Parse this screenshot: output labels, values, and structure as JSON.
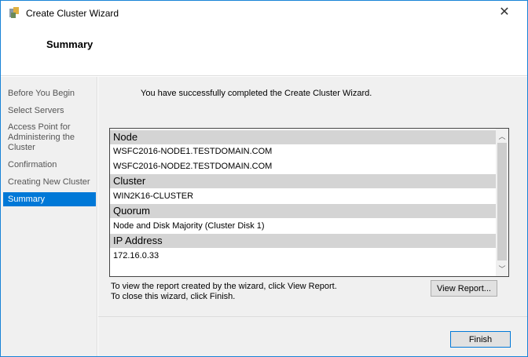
{
  "window": {
    "title": "Create Cluster Wizard",
    "close": "✕"
  },
  "header": {
    "title": "Summary"
  },
  "nav": {
    "items": [
      {
        "label": "Before You Begin"
      },
      {
        "label": "Select Servers"
      },
      {
        "label": "Access Point for Administering the Cluster"
      },
      {
        "label": "Confirmation"
      },
      {
        "label": "Creating New Cluster"
      },
      {
        "label": "Summary",
        "selected": true
      }
    ]
  },
  "main": {
    "message": "You have successfully completed the Create Cluster Wizard.",
    "sections": [
      {
        "header": "Node",
        "values": [
          "WSFC2016-NODE1.TESTDOMAIN.COM",
          "WSFC2016-NODE2.TESTDOMAIN.COM"
        ]
      },
      {
        "header": "Cluster",
        "values": [
          "WIN2K16-CLUSTER"
        ]
      },
      {
        "header": "Quorum",
        "values": [
          "Node and Disk Majority (Cluster Disk 1)"
        ]
      },
      {
        "header": "IP Address",
        "values": [
          "172.16.0.33"
        ]
      }
    ],
    "note1": "To view the report created by the wizard, click View Report.",
    "note2": "To close this wizard, click Finish.",
    "view_report": "View Report...",
    "finish": "Finish"
  },
  "colors": {
    "accent": "#0078d7",
    "section_bg": "#d4d4d4"
  }
}
